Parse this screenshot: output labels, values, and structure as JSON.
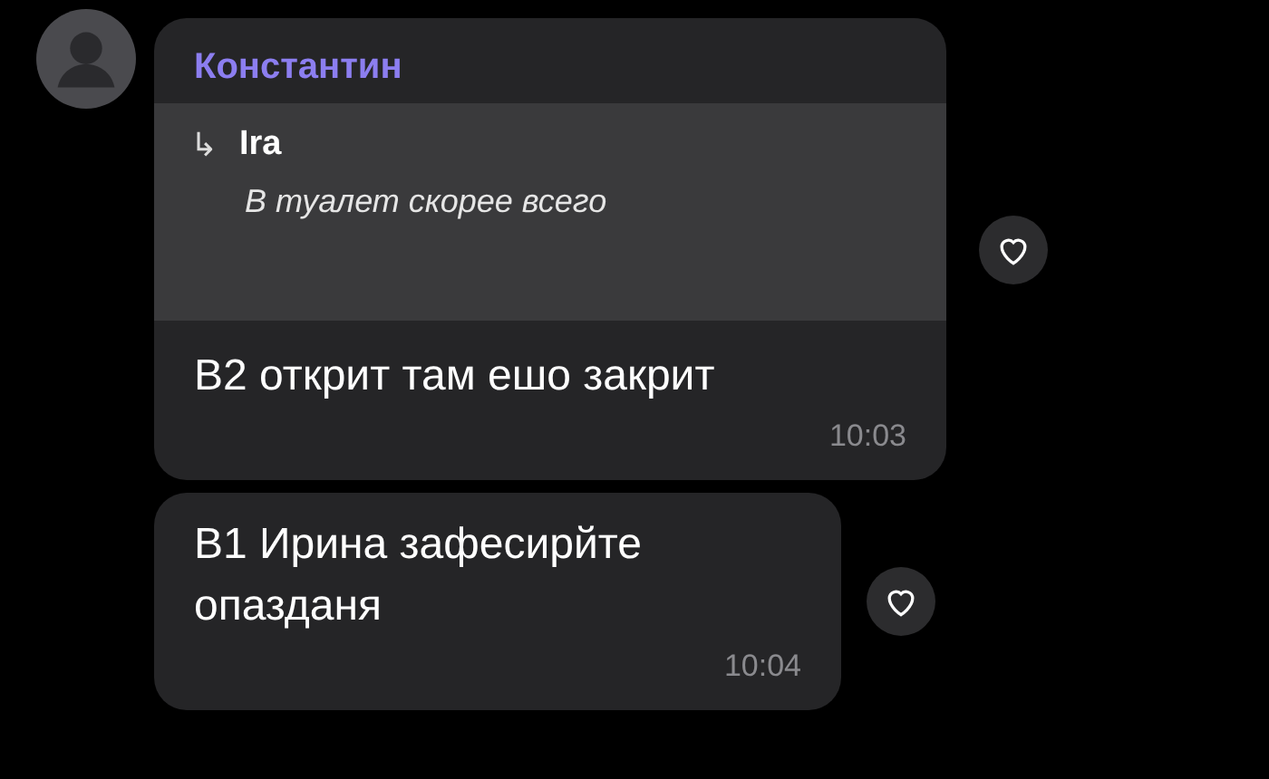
{
  "messages": [
    {
      "sender": "Константин",
      "show_avatar": true,
      "reply": {
        "arrow": "↳",
        "author": "Ira",
        "text": "В туалет скорее всего"
      },
      "text": "В2 открит там ешо закрит",
      "time": "10:03",
      "reacted": false
    },
    {
      "show_avatar": false,
      "text": "В1 Ирина зафесирйте опазданя",
      "time": "10:04",
      "reacted": false
    }
  ]
}
